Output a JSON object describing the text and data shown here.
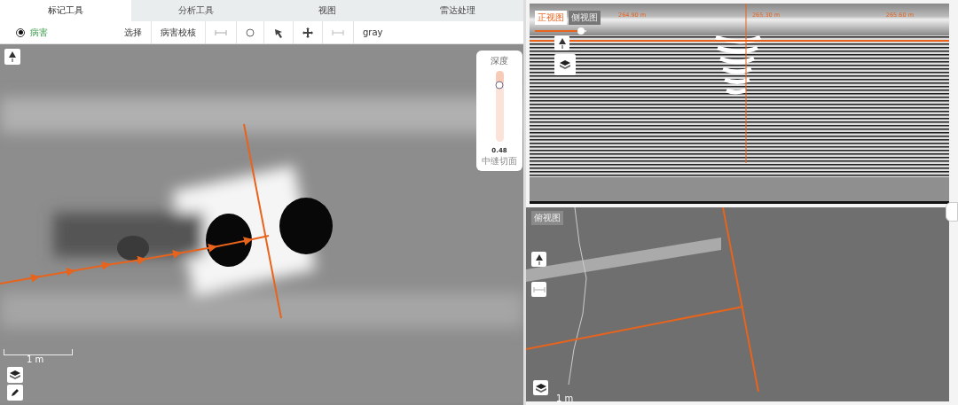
{
  "tabs": [
    {
      "label": "标记工具",
      "selected": true
    },
    {
      "label": "分析工具",
      "selected": false
    },
    {
      "label": "视图",
      "selected": false
    },
    {
      "label": "雷达处理",
      "selected": false
    }
  ],
  "toolbar": {
    "radio": {
      "label": "病害",
      "checked": true
    },
    "items": [
      {
        "kind": "text",
        "label": "选择"
      },
      {
        "kind": "text",
        "label": "病害校核"
      },
      {
        "kind": "ruler"
      },
      {
        "kind": "circle"
      },
      {
        "kind": "pick"
      },
      {
        "kind": "move"
      },
      {
        "kind": "range"
      },
      {
        "kind": "text",
        "label": "gray"
      }
    ]
  },
  "map": {
    "depth_slider": {
      "title": "深度",
      "level": 0.2,
      "value": "0.48",
      "caption": "中缝切面"
    },
    "scale": "1 m"
  },
  "radar": {
    "view_tabs": [
      {
        "label": "正视图",
        "selected": true
      },
      {
        "label": "侧视图",
        "selected": false
      }
    ],
    "range_slider": {
      "level": 0.9
    },
    "distance_labels": [
      "264.90 m",
      "265.30 m",
      "265.60 m"
    ]
  },
  "plan": {
    "label": "俯视图",
    "scale": "1 m"
  }
}
